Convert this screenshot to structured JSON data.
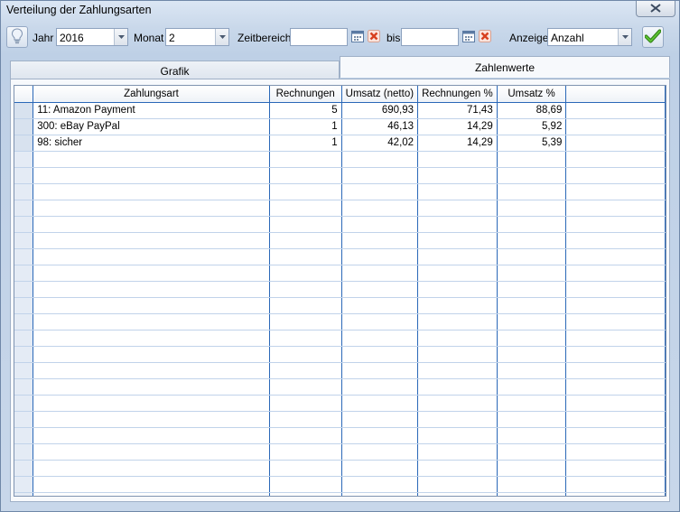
{
  "window": {
    "title": "Verteilung der Zahlungsarten"
  },
  "toolbar": {
    "jahr_label": "Jahr",
    "jahr_value": "2016",
    "monat_label": "Monat",
    "monat_value": "2",
    "zeitbereich_label": "Zeitbereich",
    "zeitbereich_from": "",
    "bis_label": "bis",
    "zeitbereich_to": "",
    "anzeige_label": "Anzeige",
    "anzeige_value": "Anzahl"
  },
  "tabs": [
    {
      "label": "Grafik",
      "active": false
    },
    {
      "label": "Zahlenwerte",
      "active": true
    }
  ],
  "table": {
    "columns": [
      "Zahlungsart",
      "Rechnungen",
      "Umsatz (netto)",
      "Rechnungen %",
      "Umsatz %"
    ],
    "rows": [
      [
        "11: Amazon Payment",
        "5",
        "690,93",
        "71,43",
        "88,69"
      ],
      [
        "300: eBay PayPal",
        "1",
        "46,13",
        "14,29",
        "5,92"
      ],
      [
        "98: sicher",
        "1",
        "42,02",
        "14,29",
        "5,39"
      ]
    ]
  },
  "colors": {
    "grid_line": "#2a68b8",
    "row_line": "#c1d3ea",
    "window_bg": "#c9d8ea",
    "ok_check": "#3a9a1e",
    "clear_x": "#d8401f"
  }
}
